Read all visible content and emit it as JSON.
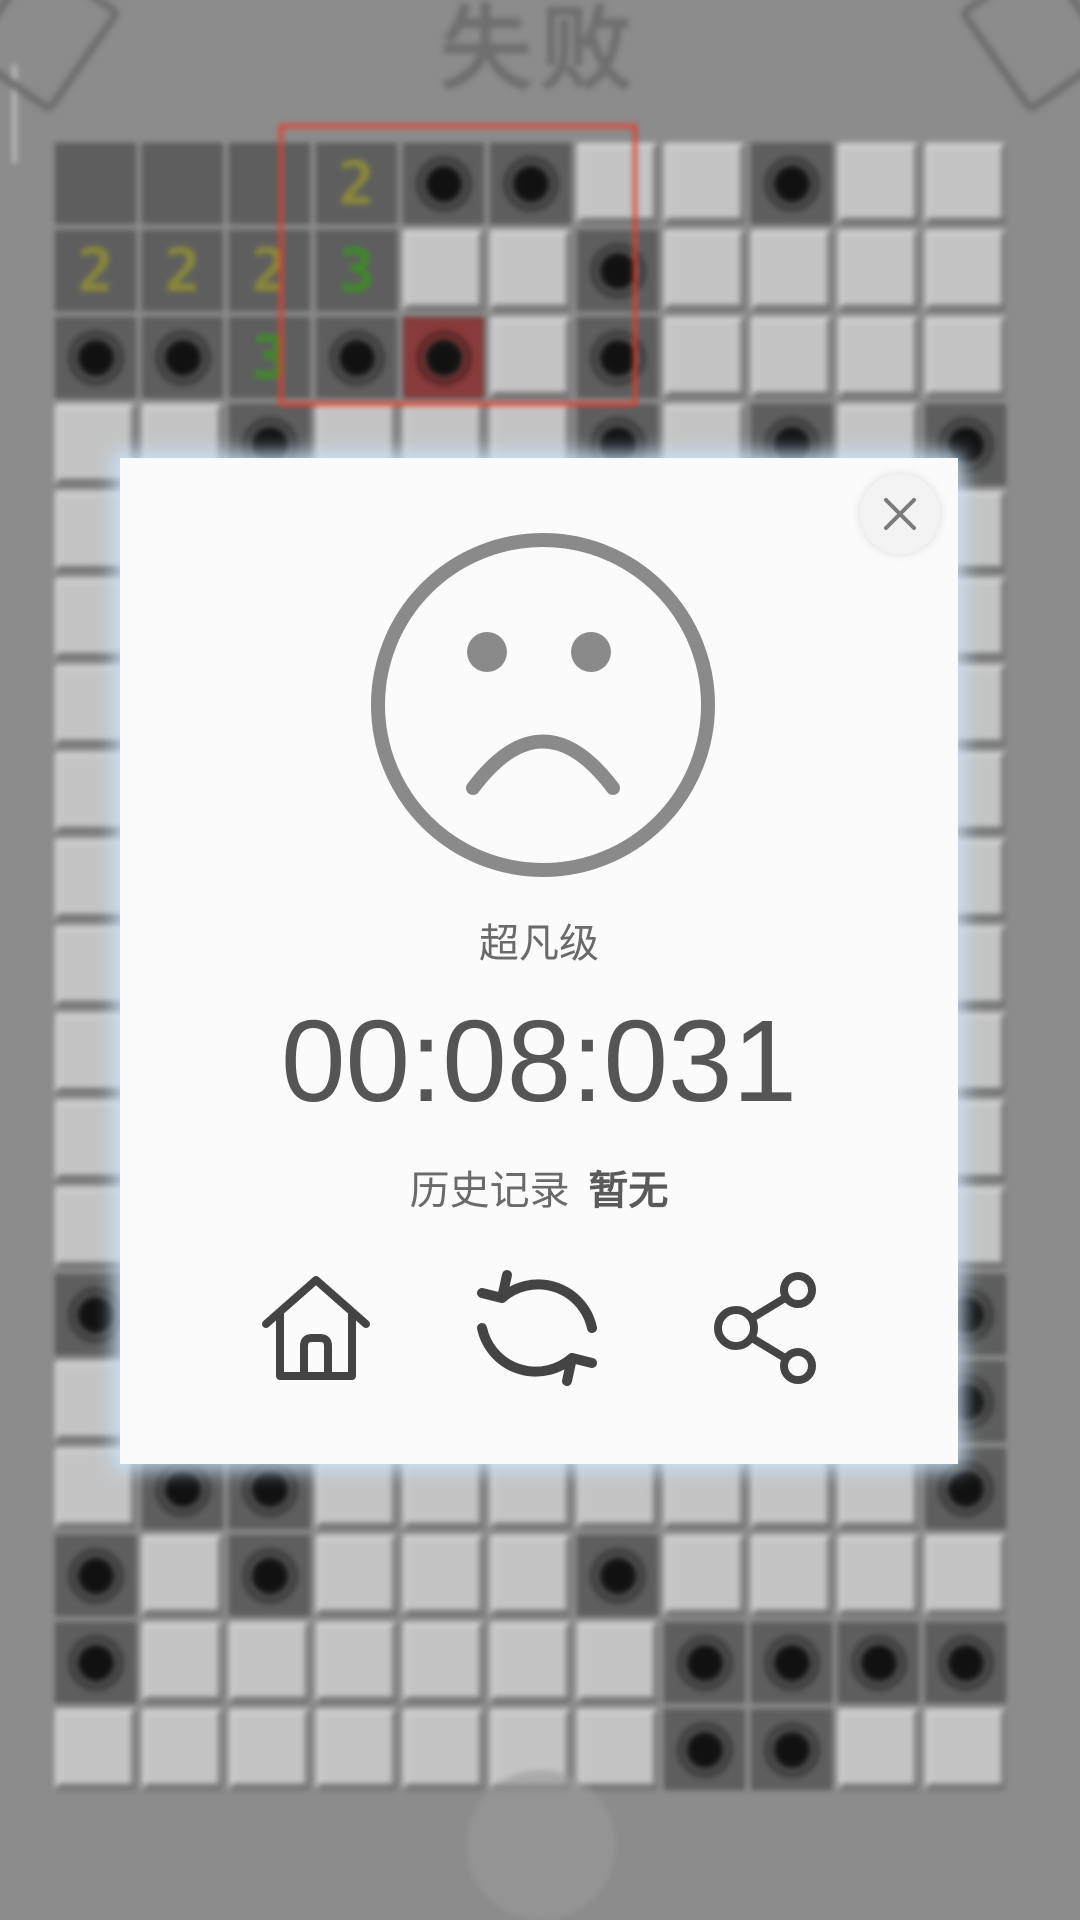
{
  "background": {
    "title": "失败",
    "board": [
      [
        "open",
        "open",
        "open",
        "open-2",
        "open-mine",
        "open-mine",
        "closed",
        "closed",
        "open-mine",
        "closed",
        "closed"
      ],
      [
        "open-2",
        "open-2",
        "open-2",
        "open-3",
        "closed",
        "closed",
        "open-mine",
        "closed",
        "closed",
        "closed",
        "closed"
      ],
      [
        "open-mine",
        "open-mine",
        "open-3",
        "open-mine",
        "exploded",
        "closed",
        "open-mine",
        "closed",
        "closed",
        "closed",
        "closed"
      ],
      [
        "closed",
        "closed",
        "open-mine",
        "closed",
        "closed",
        "closed",
        "open-mine",
        "closed",
        "open-mine",
        "closed",
        "open-mine"
      ],
      [
        "closed",
        "closed",
        "closed",
        "closed",
        "closed",
        "closed",
        "closed",
        "closed",
        "closed",
        "closed",
        "closed"
      ],
      [
        "closed",
        "closed",
        "closed",
        "closed",
        "closed",
        "closed",
        "closed",
        "closed",
        "closed",
        "closed",
        "closed"
      ],
      [
        "closed",
        "closed",
        "closed",
        "closed",
        "closed",
        "closed",
        "closed",
        "closed",
        "closed",
        "closed",
        "closed"
      ],
      [
        "closed",
        "closed",
        "closed",
        "closed",
        "closed",
        "closed",
        "closed",
        "closed",
        "closed",
        "closed",
        "closed"
      ],
      [
        "closed",
        "closed",
        "closed",
        "closed",
        "closed",
        "closed",
        "closed",
        "closed",
        "closed",
        "closed",
        "closed"
      ],
      [
        "closed",
        "closed",
        "closed",
        "closed",
        "closed",
        "closed",
        "closed",
        "closed",
        "closed",
        "closed",
        "closed"
      ],
      [
        "closed",
        "closed",
        "closed",
        "closed",
        "closed",
        "closed",
        "closed",
        "closed",
        "closed",
        "closed",
        "closed"
      ],
      [
        "closed",
        "closed",
        "closed",
        "closed",
        "closed",
        "closed",
        "closed",
        "closed",
        "closed",
        "closed",
        "closed"
      ],
      [
        "closed",
        "closed",
        "closed",
        "closed",
        "closed",
        "closed",
        "closed",
        "closed",
        "closed",
        "closed",
        "closed"
      ],
      [
        "open-mine",
        "closed",
        "closed",
        "closed",
        "closed",
        "closed",
        "closed",
        "closed",
        "closed",
        "closed",
        "open-mine"
      ],
      [
        "closed",
        "closed",
        "closed",
        "closed",
        "closed",
        "closed",
        "open-mine",
        "closed",
        "open-mine",
        "closed",
        "open-mine"
      ],
      [
        "closed",
        "open-mine",
        "open-mine",
        "closed",
        "closed",
        "closed",
        "closed",
        "closed",
        "closed",
        "closed",
        "open-mine"
      ],
      [
        "open-mine",
        "closed",
        "open-mine",
        "closed",
        "closed",
        "closed",
        "open-mine",
        "closed",
        "closed",
        "closed",
        "closed"
      ],
      [
        "open-mine",
        "closed",
        "closed",
        "closed",
        "closed",
        "closed",
        "closed",
        "open-mine",
        "open-mine",
        "open-mine",
        "open-mine"
      ],
      [
        "closed",
        "closed",
        "closed",
        "closed",
        "closed",
        "closed",
        "closed",
        "open-mine",
        "open-mine",
        "closed",
        "closed"
      ]
    ]
  },
  "dialog": {
    "level": "超凡级",
    "time": "00:08:031",
    "history_label": "历史记录",
    "history_value": "暂无",
    "close_icon": "close-icon",
    "face_icon": "sad-face-icon",
    "actions": {
      "home_icon": "home-icon",
      "restart_icon": "restart-icon",
      "share_icon": "share-icon"
    }
  },
  "colors": {
    "highlight": "#e0402f",
    "dialog_bg": "#fbfbfb",
    "dialog_glow": "#c8e6ff"
  }
}
